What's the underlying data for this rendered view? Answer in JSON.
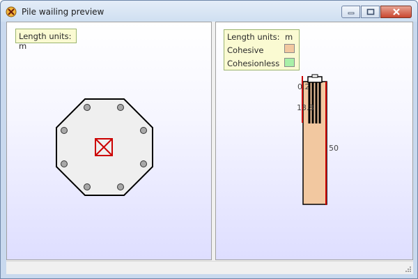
{
  "window": {
    "title": "Pile wailing preview",
    "icon": "app-logo-icon",
    "controls": [
      "minimize-icon",
      "maximize-icon",
      "close-icon"
    ]
  },
  "plan_view": {
    "legend_text": "Length units: m",
    "shape": "octagon",
    "pile_count": 8,
    "center_marker": "boxed-cross"
  },
  "section_view": {
    "legend": {
      "units_label": "Length units:",
      "units_value": "m",
      "soil_types": [
        {
          "label": "Cohesive",
          "color": "#f2c8a0"
        },
        {
          "label": "Cohesionless",
          "color": "#a8f0a8"
        }
      ]
    },
    "labels": {
      "top_level": "0.2",
      "mid_level": "13.8",
      "pile_length": "50"
    }
  },
  "colors": {
    "cohesive": "#f2c8a0",
    "cohesionless": "#a8f0a8",
    "dimension_line": "#cc0000",
    "center_marker": "#cc0000"
  }
}
